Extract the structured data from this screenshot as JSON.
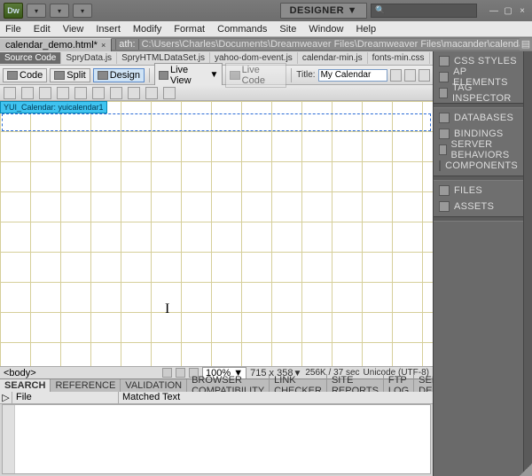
{
  "titlebar": {
    "designer_label": "DESIGNER",
    "search_placeholder": ""
  },
  "menu": [
    "File",
    "Edit",
    "View",
    "Insert",
    "Modify",
    "Format",
    "Commands",
    "Site",
    "Window",
    "Help"
  ],
  "doc_tab": {
    "label": "calendar_demo.html*"
  },
  "path": {
    "prefix": "ath:",
    "value": "C:\\Users\\Charles\\Documents\\Dreamweaver Files\\Dreamweaver Files\\macander\\calendar_demo.html"
  },
  "related_files": [
    "Source Code",
    "SpryData.js",
    "SpryHTMLDataSet.js",
    "yahoo-dom-event.js",
    "calendar-min.js",
    "fonts-min.css",
    "c"
  ],
  "viewbar": {
    "code": "Code",
    "split": "Split",
    "design": "Design",
    "liveview": "Live View",
    "livecode": "Live Code",
    "title_label": "Title:",
    "title_value": "My Calendar"
  },
  "widget_tag": "YUI_Calendar: yuicalendar1",
  "tag_selector": "<body>",
  "status": {
    "zoom": "100%",
    "dims": "715 x 358",
    "size": "256K / 37 sec",
    "encoding": "Unicode (UTF-8)"
  },
  "results": {
    "tabs": [
      "SEARCH",
      "REFERENCE",
      "VALIDATION",
      "BROWSER COMPATIBILITY",
      "LINK CHECKER",
      "SITE REPORTS",
      "FTP LOG",
      "SERVER DEBUG"
    ],
    "col_file": "File",
    "col_matched": "Matched Text"
  },
  "panels": {
    "g1": [
      "CSS STYLES",
      "AP ELEMENTS",
      "TAG INSPECTOR"
    ],
    "g2": [
      "DATABASES",
      "BINDINGS",
      "SERVER BEHAVIORS",
      "COMPONENTS"
    ],
    "g3": [
      "FILES",
      "ASSETS"
    ]
  }
}
